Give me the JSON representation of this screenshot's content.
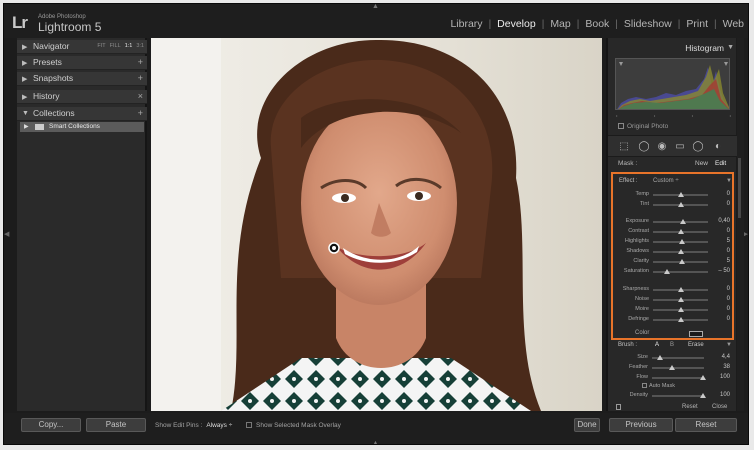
{
  "app": {
    "logo": "Lr",
    "brand_small": "Adobe Photoshop",
    "brand_big": "Lightroom 5"
  },
  "modules": [
    "Library",
    "Develop",
    "Map",
    "Book",
    "Slideshow",
    "Print",
    "Web"
  ],
  "active_module": "Develop",
  "left_panel": {
    "navigator": {
      "label": "Navigator",
      "opts": [
        "FIT",
        "FILL",
        "1:1",
        "3:1"
      ]
    },
    "presets": {
      "label": "Presets",
      "action": "+"
    },
    "snapshots": {
      "label": "Snapshots",
      "action": "+"
    },
    "history": {
      "label": "History",
      "action": "×"
    },
    "collections": {
      "label": "Collections",
      "action": "+"
    },
    "smart_collections": "Smart Collections"
  },
  "right_panel": {
    "histogram_label": "Histogram",
    "original_photo": "Original Photo",
    "mask_label": "Mask :",
    "mask_new": "New",
    "mask_edit": "Edit",
    "effect_label": "Effect :",
    "effect_value": "Custom ÷",
    "sliders": [
      {
        "label": "Temp",
        "value": "0",
        "pos": 0.5
      },
      {
        "label": "Tint",
        "value": "0",
        "pos": 0.5
      },
      {
        "label": "Exposure",
        "value": "0,40",
        "pos": 0.54
      },
      {
        "label": "Contrast",
        "value": "0",
        "pos": 0.5
      },
      {
        "label": "Highlights",
        "value": "5",
        "pos": 0.52
      },
      {
        "label": "Shadows",
        "value": "0",
        "pos": 0.5
      },
      {
        "label": "Clarity",
        "value": "5",
        "pos": 0.52
      },
      {
        "label": "Saturation",
        "value": "– 50",
        "pos": 0.25
      },
      {
        "label": "Sharpness",
        "value": "0",
        "pos": 0.5
      },
      {
        "label": "Noise",
        "value": "0",
        "pos": 0.5
      },
      {
        "label": "Moire",
        "value": "0",
        "pos": 0.5
      },
      {
        "label": "Defringe",
        "value": "0",
        "pos": 0.5
      }
    ],
    "color_label": "Color",
    "brush": {
      "label": "Brush :",
      "a": "A",
      "b": "B",
      "erase": "Erase"
    },
    "brush_sliders": [
      {
        "label": "Size",
        "value": "4,4",
        "pos": 0.15
      },
      {
        "label": "Feather",
        "value": "38",
        "pos": 0.38
      },
      {
        "label": "Flow",
        "value": "100",
        "pos": 0.98
      },
      {
        "label": "Density",
        "value": "100",
        "pos": 0.98
      }
    ],
    "auto_mask": "Auto Mask",
    "reset": "Reset",
    "close": "Close"
  },
  "bottom": {
    "copy": "Copy...",
    "paste": "Paste",
    "show_edit_pins_label": "Show Edit Pins :",
    "show_edit_pins_value": "Always ÷",
    "show_overlay": "Show Selected Mask Overlay",
    "done": "Done",
    "previous": "Previous",
    "reset": "Reset"
  },
  "colors": {
    "accent": "#e8742a",
    "panel_bg": "#282828",
    "frame_bg": "#1c1c1c"
  }
}
